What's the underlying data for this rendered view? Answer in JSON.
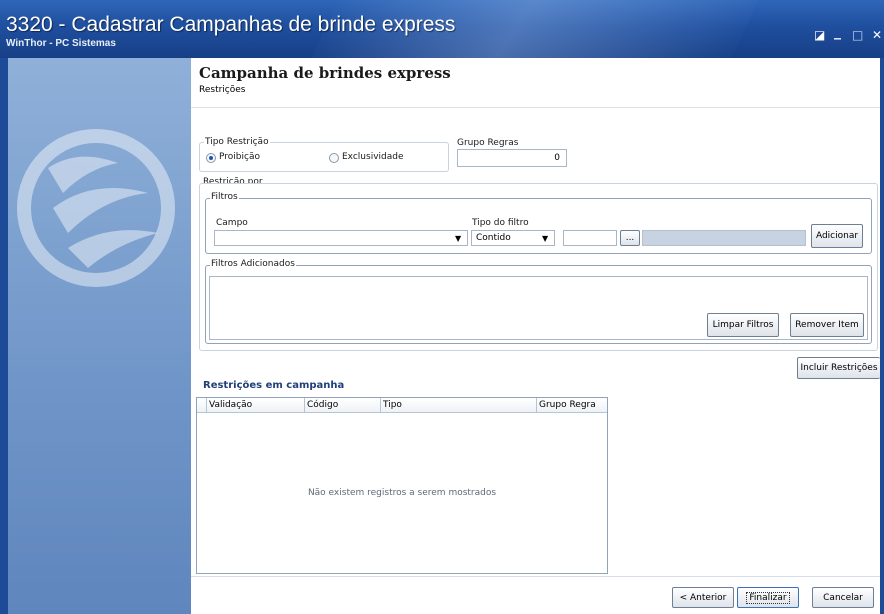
{
  "window": {
    "title": "3320 - Cadastrar Campanhas de brinde express",
    "subtitle": "WinThor - PC Sistemas",
    "controls": [
      "◪",
      "_",
      "□",
      "✕"
    ]
  },
  "header": {
    "title": "Campanha de brindes express",
    "step": "Restrições"
  },
  "tipo_restricao": {
    "label": "Tipo Restrição",
    "options": [
      {
        "label": "Proibição",
        "selected": true
      },
      {
        "label": "Exclusividade",
        "selected": false
      }
    ]
  },
  "grupo_regras": {
    "label": "Grupo Regras",
    "value": "0"
  },
  "restricao_por": {
    "label": "Restrição por",
    "filtros_label": "Filtros",
    "campo_label": "Campo",
    "campo_value": "",
    "tipo_filtro_label": "Tipo do filtro",
    "tipo_filtro_value": "Contido",
    "valor": "",
    "browse_label": "...",
    "adicionar_label": "Adicionar"
  },
  "filtros_adicionados": {
    "label": "Filtros Adicionados",
    "limpar_label": "Limpar Filtros",
    "remover_label": "Remover Item"
  },
  "incluir_label": "Incluir Restrições",
  "restricoes": {
    "title": "Restrições em campanha",
    "columns": [
      "Validação",
      "Código",
      "Tipo",
      "Grupo Regra"
    ],
    "empty_message": "Não existem registros a serem mostrados"
  },
  "footer": {
    "anterior_label": "< Anterior",
    "finalizar_label": "Finalizar",
    "cancelar_label": "Cancelar"
  }
}
